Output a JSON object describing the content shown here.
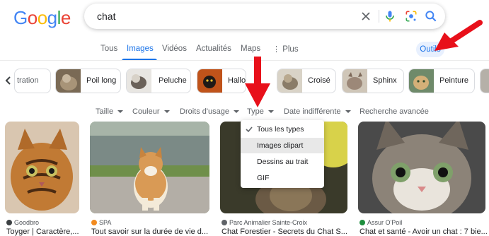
{
  "logo": {
    "letters": [
      "G",
      "o",
      "o",
      "g",
      "l",
      "e"
    ],
    "colors": [
      "#4285f4",
      "#ea4335",
      "#fbbc05",
      "#4285f4",
      "#34a853",
      "#ea4335"
    ]
  },
  "search": {
    "query": "chat"
  },
  "tabs": [
    {
      "label": "Tous",
      "active": false
    },
    {
      "label": "Images",
      "active": true
    },
    {
      "label": "Vidéos",
      "active": false
    },
    {
      "label": "Actualités",
      "active": false
    },
    {
      "label": "Maps",
      "active": false
    },
    {
      "label": "Plus",
      "active": false
    }
  ],
  "tools": {
    "label": "Outils"
  },
  "chips": [
    {
      "label": "tration"
    },
    {
      "label": "Poil long"
    },
    {
      "label": "Peluche"
    },
    {
      "label": "Hallo"
    },
    {
      "label": "Croisé"
    },
    {
      "label": "Sphinx"
    },
    {
      "label": "Peinture"
    }
  ],
  "filters": [
    {
      "label": "Taille"
    },
    {
      "label": "Couleur"
    },
    {
      "label": "Droits d'usage"
    },
    {
      "label": "Type"
    },
    {
      "label": "Date indifférente"
    },
    {
      "label": "Recherche avancée"
    }
  ],
  "dropdown": {
    "items": [
      {
        "label": "Tous les types",
        "checked": true
      },
      {
        "label": "Images clipart",
        "hover": true
      },
      {
        "label": "Dessins au trait"
      },
      {
        "label": "GIF"
      }
    ]
  },
  "results": [
    {
      "source": "Goodbro",
      "title": "Toyger | Caractère,...",
      "fav_color": "#3c4043"
    },
    {
      "source": "SPA",
      "title": "Tout savoir sur la durée de vie d...",
      "fav_color": "#f28b20"
    },
    {
      "source": "Parc Animalier Sainte-Croix",
      "title": "Chat Forestier - Secrets du Chat S...",
      "fav_color": "#5f6368"
    },
    {
      "source": "Assur O'Poil",
      "title": "Chat et santé - Avoir un chat : 7 bie...",
      "fav_color": "#1e8e3e"
    }
  ],
  "colors": {
    "accent": "#1a73e8",
    "arrow": "#e8101a"
  }
}
